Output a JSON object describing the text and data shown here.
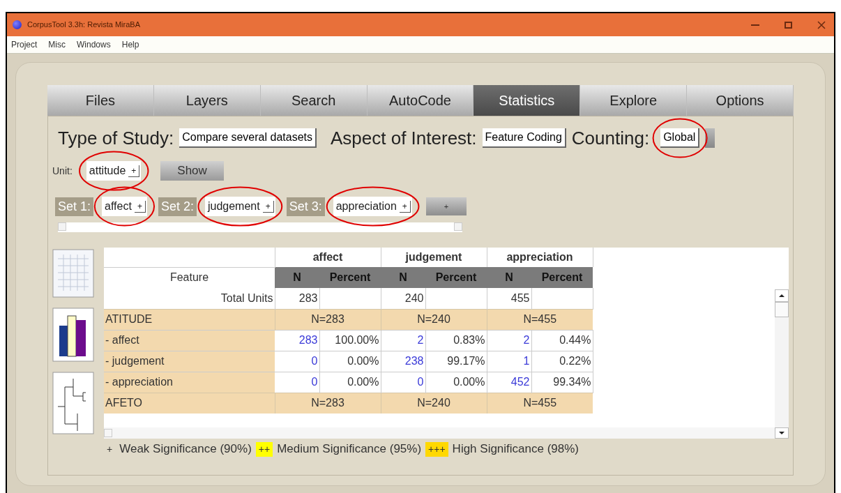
{
  "window": {
    "title": "CorpusTool 3.3h: Revista MiraBA"
  },
  "menu": [
    "Project",
    "Misc",
    "Windows",
    "Help"
  ],
  "tabs": [
    {
      "label": "Files",
      "selected": false
    },
    {
      "label": "Layers",
      "selected": false
    },
    {
      "label": "Search",
      "selected": false
    },
    {
      "label": "AutoCode",
      "selected": false
    },
    {
      "label": "Statistics",
      "selected": true
    },
    {
      "label": "Explore",
      "selected": false
    },
    {
      "label": "Options",
      "selected": false
    }
  ],
  "study": {
    "type_label": "Type of Study:",
    "type_value": "Compare several datasets",
    "aspect_label": "Aspect of Interest:",
    "aspect_value": "Feature Coding",
    "counting_label": "Counting:",
    "counting_value": "Global",
    "counting_circled": true
  },
  "unit": {
    "label": "Unit:",
    "value": "attitude",
    "caret": "+",
    "circled": true,
    "show_button": "Show"
  },
  "sets": [
    {
      "label": "Set 1:",
      "value": "affect",
      "caret": "+",
      "circled": true
    },
    {
      "label": "Set 2:",
      "value": "judgement",
      "caret": "+",
      "circled": true
    },
    {
      "label": "Set 3:",
      "value": "appreciation",
      "caret": "+",
      "circled": true
    }
  ],
  "add_set_button": "+",
  "table": {
    "feature_header": "Feature",
    "groups": [
      {
        "name": "affect",
        "n_header": "N",
        "pct_header": "Percent"
      },
      {
        "name": "judgement",
        "n_header": "N",
        "pct_header": "Percent"
      },
      {
        "name": "appreciation",
        "n_header": "N",
        "pct_header": "Percent"
      }
    ],
    "rows": [
      {
        "kind": "total",
        "label": "Total Units",
        "values": [
          "283",
          "240",
          "455"
        ]
      },
      {
        "kind": "category",
        "label": "ATITUDE",
        "values": [
          "N=283",
          "N=240",
          "N=455"
        ]
      },
      {
        "kind": "feature",
        "label": "- affect",
        "cells": [
          {
            "n": "283",
            "pct": "100.00%"
          },
          {
            "n": "2",
            "pct": "0.83%"
          },
          {
            "n": "2",
            "pct": "0.44%"
          }
        ]
      },
      {
        "kind": "feature",
        "label": "- judgement",
        "cells": [
          {
            "n": "0",
            "pct": "0.00%"
          },
          {
            "n": "238",
            "pct": "99.17%"
          },
          {
            "n": "1",
            "pct": "0.22%"
          }
        ]
      },
      {
        "kind": "feature",
        "label": "- appreciation",
        "cells": [
          {
            "n": "0",
            "pct": "0.00%"
          },
          {
            "n": "0",
            "pct": "0.00%"
          },
          {
            "n": "452",
            "pct": "99.34%"
          }
        ]
      },
      {
        "kind": "category",
        "label": "AFETO",
        "values": [
          "N=283",
          "N=240",
          "N=455"
        ]
      }
    ]
  },
  "legend": [
    {
      "mark": "+",
      "text": "Weak Significance (90%)"
    },
    {
      "mark": "++",
      "text": "Medium Significance (95%)",
      "color": "#ffff00"
    },
    {
      "mark": "+++",
      "text": "High Significance (98%)",
      "color": "#ffd800"
    }
  ]
}
